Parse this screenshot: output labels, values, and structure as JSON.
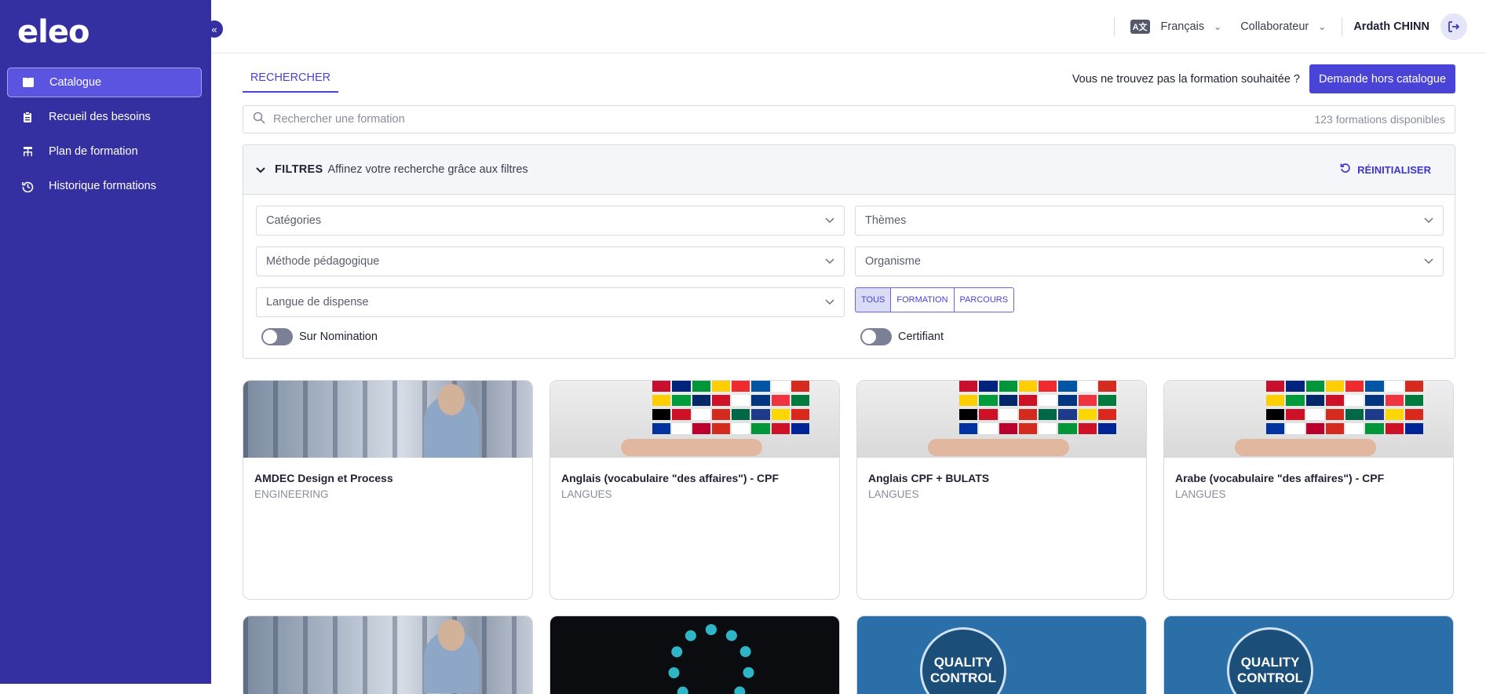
{
  "sidebar": {
    "logo": "eleo",
    "collapse_icon": "«",
    "items": [
      {
        "label": "Catalogue",
        "icon": "book-icon",
        "active": true
      },
      {
        "label": "Recueil des besoins",
        "icon": "clipboard-icon",
        "active": false
      },
      {
        "label": "Plan de formation",
        "icon": "org-chart-icon",
        "active": false
      },
      {
        "label": "Historique formations",
        "icon": "history-icon",
        "active": false
      }
    ]
  },
  "header": {
    "language": "Français",
    "role": "Collaborateur",
    "user": "Ardath CHINN"
  },
  "main": {
    "tab": "RECHERCHER",
    "not_found_text": "Vous ne trouvez pas la formation souhaitée ?",
    "request_button": "Demande hors catalogue",
    "search_placeholder": "Rechercher une formation",
    "search_count": "123 formations disponibles",
    "filters": {
      "title": "FILTRES",
      "subtitle": "Affinez votre recherche grâce aux filtres",
      "reset": "RÉINITIALISER",
      "categories": "Catégories",
      "themes": "Thèmes",
      "method": "Méthode pédagogique",
      "organism": "Organisme",
      "language": "Langue de dispense",
      "segment": [
        "TOUS",
        "FORMATION",
        "PARCOURS"
      ],
      "segment_selected": "TOUS",
      "toggle_nomination": "Sur Nomination",
      "toggle_certifiant": "Certifiant"
    },
    "cards": [
      {
        "title": "AMDEC Design et Process",
        "category": "ENGINEERING",
        "image": "engineering-photo"
      },
      {
        "title": "Anglais (vocabulaire \"des affaires\") - CPF",
        "category": "LANGUES",
        "image": "flags-photo"
      },
      {
        "title": "Anglais CPF + BULATS",
        "category": "LANGUES",
        "image": "flags-photo"
      },
      {
        "title": "Arabe (vocabulaire \"des affaires\") - CPF",
        "category": "LANGUES",
        "image": "flags-photo"
      }
    ],
    "qc_text": "QUALITY CONTROL"
  },
  "colors": {
    "sidebar": "#3530a1",
    "accent": "#4a43d8",
    "active_item": "#5b54e0"
  }
}
